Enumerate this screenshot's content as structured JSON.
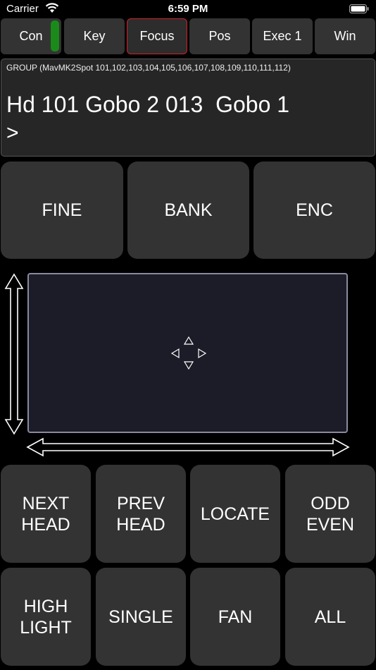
{
  "status_bar": {
    "carrier": "Carrier",
    "time": "6:59 PM"
  },
  "tabs": [
    {
      "label": "Con"
    },
    {
      "label": "Key"
    },
    {
      "label": "Focus",
      "active": true
    },
    {
      "label": "Pos"
    },
    {
      "label": "Exec 1"
    },
    {
      "label": "Win"
    }
  ],
  "colors": {
    "active_tab_border": "#d0202a",
    "connection_indicator": "#1a8a1a",
    "button_bg": "#333333",
    "pad_bg": "#1c1c28"
  },
  "command": {
    "group_line": "GROUP (MavMK2Spot 101,102,103,104,105,106,107,108,109,110,111,112)",
    "command_line": "Hd 101 Gobo 2 013  Gobo 1",
    "prompt": ">"
  },
  "top_buttons": {
    "fine": "FINE",
    "bank": "BANK",
    "enc": "ENC"
  },
  "grid_buttons": {
    "next_head": [
      "NEXT",
      "HEAD"
    ],
    "prev_head": [
      "PREV",
      "HEAD"
    ],
    "locate": "LOCATE",
    "odd_even": [
      "ODD",
      "EVEN"
    ],
    "highlight": [
      "HIGH",
      "LIGHT"
    ],
    "single": "SINGLE",
    "fan": "FAN",
    "all": "ALL"
  }
}
